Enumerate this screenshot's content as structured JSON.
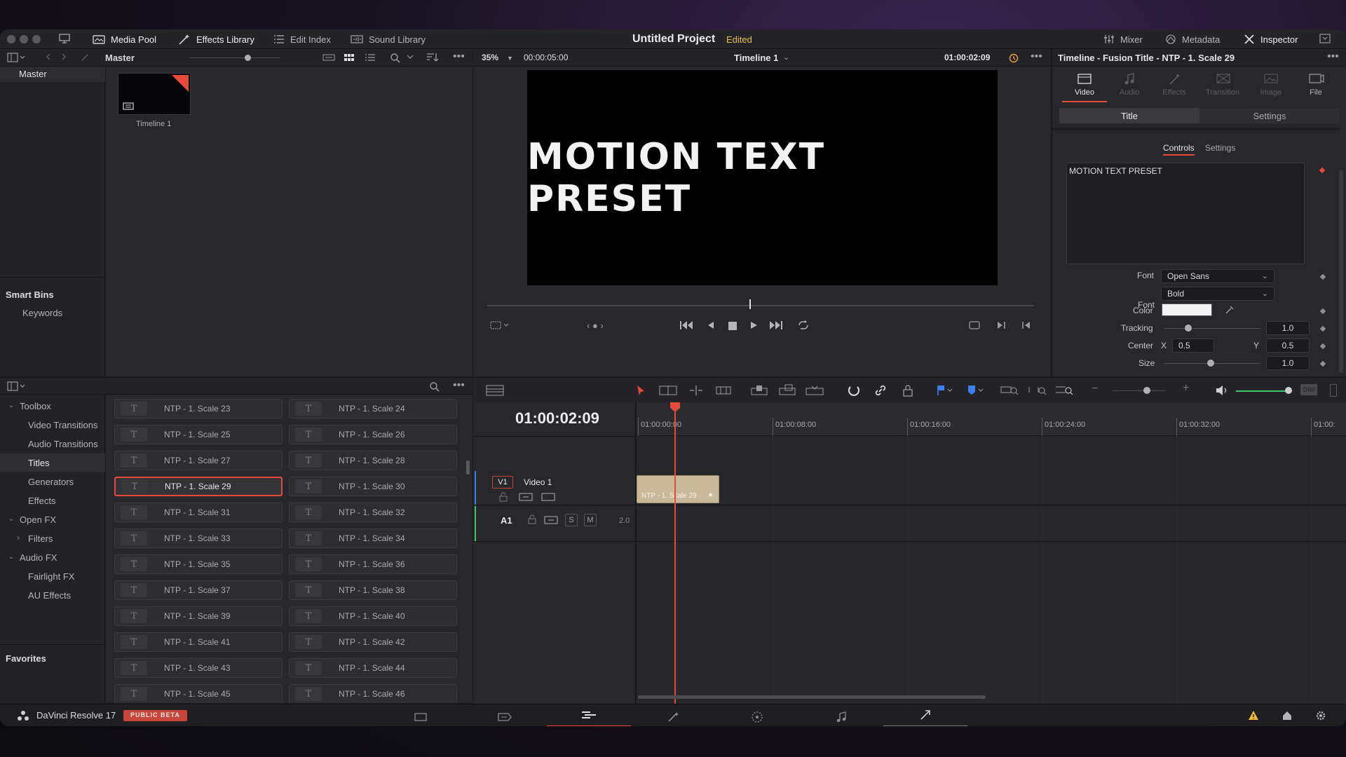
{
  "topbar": {
    "tabs_left": [
      {
        "label": "Media Pool",
        "icon": "media-pool-icon"
      },
      {
        "label": "Effects Library",
        "icon": "effects-library-icon"
      },
      {
        "label": "Edit Index",
        "icon": "edit-index-icon"
      },
      {
        "label": "Sound Library",
        "icon": "sound-library-icon"
      }
    ],
    "project_title": "Untitled Project",
    "edited_badge": "Edited",
    "tabs_right": [
      {
        "label": "Mixer",
        "icon": "mixer-icon"
      },
      {
        "label": "Metadata",
        "icon": "metadata-icon"
      },
      {
        "label": "Inspector",
        "icon": "inspector-icon"
      }
    ]
  },
  "media_pool": {
    "bin_title": "Master",
    "bins": [
      "Master"
    ],
    "smart_bins_label": "Smart Bins",
    "smart_bins": [
      "Keywords"
    ],
    "clip_name": "Timeline 1"
  },
  "effects": {
    "toolbox": "Toolbox",
    "items": [
      "Video Transitions",
      "Audio Transitions",
      "Titles",
      "Generators",
      "Effects"
    ],
    "open_fx": "Open FX",
    "filters": "Filters",
    "audio_fx": "Audio FX",
    "audio_items": [
      "Fairlight FX",
      "AU Effects"
    ],
    "favorites": "Favorites",
    "titles_left": [
      "NTP - 1. Scale 23",
      "NTP - 1. Scale 25",
      "NTP - 1. Scale 27",
      "NTP - 1. Scale 29",
      "NTP - 1. Scale 31",
      "NTP - 1. Scale 33",
      "NTP - 1. Scale 35",
      "NTP - 1. Scale 37",
      "NTP - 1. Scale 39",
      "NTP - 1. Scale 41",
      "NTP - 1. Scale 43",
      "NTP - 1. Scale 45"
    ],
    "titles_right": [
      "NTP - 1. Scale 24",
      "NTP - 1. Scale 26",
      "NTP - 1. Scale 28",
      "NTP - 1. Scale 30",
      "NTP - 1. Scale 32",
      "NTP - 1. Scale 34",
      "NTP - 1. Scale 36",
      "NTP - 1. Scale 38",
      "NTP - 1. Scale 40",
      "NTP - 1. Scale 42",
      "NTP - 1. Scale 44",
      "NTP - 1. Scale 46"
    ],
    "selected": "NTP - 1. Scale 29"
  },
  "viewer": {
    "zoom": "35%",
    "duration": "00:00:05:00",
    "timeline_name": "Timeline 1",
    "timecode": "01:00:02:09",
    "preview_text": "MOTION TEXT PRESET",
    "playhead_fraction": 0.48
  },
  "inspector": {
    "title": "Timeline - Fusion Title - NTP - 1. Scale 29",
    "tabs": [
      "Video",
      "Audio",
      "Effects",
      "Transition",
      "Image",
      "File"
    ],
    "subtabs": [
      "Title",
      "Settings"
    ],
    "inner_tabs": [
      "Controls",
      "Settings"
    ],
    "text_value": "MOTION TEXT PRESET",
    "font_label": "Font",
    "font": "Open Sans",
    "font_style": "Bold",
    "color_label": "Color",
    "tracking_label": "Tracking",
    "tracking": "1.0",
    "center_label": "Center",
    "x_label": "X",
    "center_x": "0.5",
    "y_label": "Y",
    "center_y": "0.5",
    "size_label": "Size",
    "size": "1.0",
    "accent": "#e64a3c"
  },
  "timeline": {
    "timecode": "01:00:02:09",
    "ruler": [
      "01:00:00:00",
      "01:00:08:00",
      "01:00:16:00",
      "01:00:24:00",
      "01:00:32:00",
      "01:00:"
    ],
    "v1_label": "V1",
    "v1_name": "Video 1",
    "a1_label": "A1",
    "a1_level": "2.0",
    "solo": "S",
    "mute": "M",
    "clip_name": "NTP - 1. Scale 29",
    "clip_color": "#c9b89a",
    "dim": "DIM"
  },
  "bottombar": {
    "app_name": "DaVinci Resolve 17",
    "beta_badge": "PUBLIC BETA",
    "pages": [
      "media-page-icon",
      "cut-page-icon",
      "edit-page-icon",
      "fusion-page-icon",
      "color-page-icon",
      "fairlight-page-icon",
      "deliver-page-icon"
    ]
  }
}
